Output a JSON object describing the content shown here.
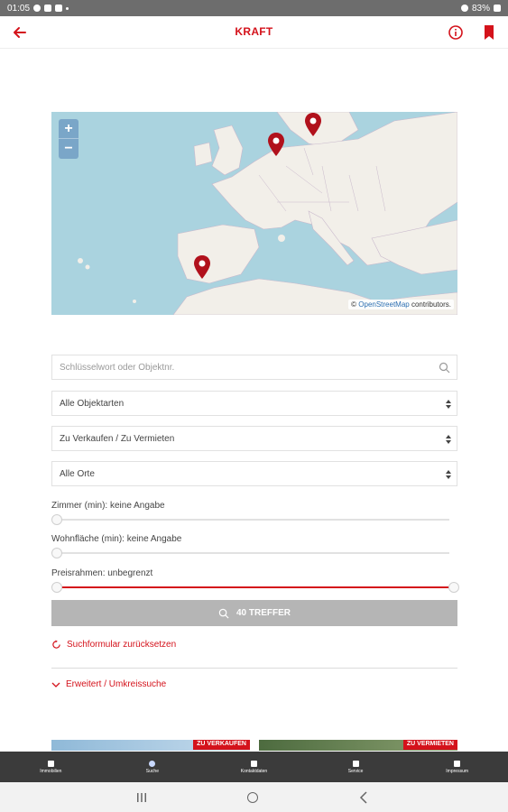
{
  "statusbar": {
    "time": "01:05",
    "battery": "83%"
  },
  "appbar": {
    "title": "KRAFT"
  },
  "map": {
    "zoom_in": "+",
    "zoom_out": "−",
    "attribution_prefix": "© ",
    "attribution_link": "OpenStreetMap",
    "attribution_suffix": " contributors."
  },
  "search": {
    "placeholder": "Schlüsselwort oder Objektnr.",
    "property_type": "Alle Objektarten",
    "offer_type": "Zu Verkaufen / Zu Vermieten",
    "location": "Alle Orte"
  },
  "sliders": {
    "rooms_label": "Zimmer (min): keine Angabe",
    "rooms_level": 0,
    "area_label": "Wohnfläche (min): keine Angabe",
    "area_level": 0,
    "price_label": "Preisrahmen: unbegrenzt",
    "price_range": [
      0,
      1
    ]
  },
  "results_button": "40 TREFFER",
  "reset_link": "Suchformular zurücksetzen",
  "advanced_link": "Erweitert / Umkreissuche",
  "teasers": {
    "sale_badge": "ZU VERKAUFEN",
    "rent_badge": "ZU VERMIETEN"
  },
  "bottom_nav": {
    "items": [
      {
        "label": "Immobilien",
        "icon": "home-icon"
      },
      {
        "label": "Suche",
        "icon": "search-icon"
      },
      {
        "label": "Kontaktdaten",
        "icon": "contact-icon"
      },
      {
        "label": "Service",
        "icon": "info-icon"
      },
      {
        "label": "Impressum",
        "icon": "document-icon"
      }
    ]
  },
  "colors": {
    "accent": "#d4121b",
    "button_disabled": "#b5b5b5",
    "nav_bg": "#3b3b3b"
  }
}
